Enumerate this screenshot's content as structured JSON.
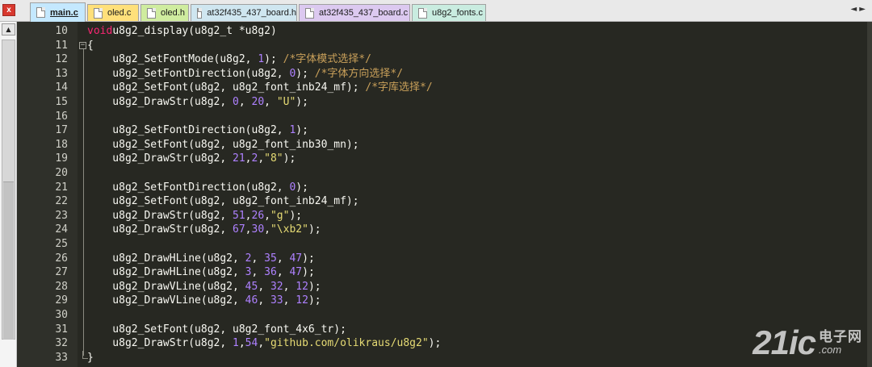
{
  "window": {
    "close_glyph": "x",
    "tab_scroll_glyph": "◄ ►"
  },
  "tabs": [
    {
      "label": "main.c",
      "active": true,
      "color": "#c4e8ff"
    },
    {
      "label": "oled.c",
      "active": false,
      "color": "#ffe07a"
    },
    {
      "label": "oled.h",
      "active": false,
      "color": "#cfec9f"
    },
    {
      "label": "at32f435_437_board.h",
      "active": false,
      "color": "#cfe6f0"
    },
    {
      "label": "at32f435_437_board.c",
      "active": false,
      "color": "#dcc9f0"
    },
    {
      "label": "u8g2_fonts.c",
      "active": false,
      "color": "#c9ece0"
    }
  ],
  "scrollbar": {
    "up_glyph": "▲"
  },
  "editor": {
    "lines": [
      {
        "n": "10",
        "fold": "",
        "tokens": [
          [
            "kw",
            "void"
          ],
          [
            "",
            "u8g2_display(u8g2_t *u8g2)"
          ]
        ]
      },
      {
        "n": "11",
        "fold": "open",
        "tokens": [
          [
            "",
            "{"
          ]
        ]
      },
      {
        "n": "12",
        "fold": "",
        "tokens": [
          [
            "",
            "    u8g2_SetFontMode(u8g2, "
          ],
          [
            "num",
            "1"
          ],
          [
            "",
            "); "
          ],
          [
            "cmt",
            "/*字体模式选择*/"
          ]
        ]
      },
      {
        "n": "13",
        "fold": "",
        "tokens": [
          [
            "",
            "    u8g2_SetFontDirection(u8g2, "
          ],
          [
            "num",
            "0"
          ],
          [
            "",
            "); "
          ],
          [
            "cmt",
            "/*字体方向选择*/"
          ]
        ]
      },
      {
        "n": "14",
        "fold": "",
        "tokens": [
          [
            "",
            "    u8g2_SetFont(u8g2, u8g2_font_inb24_mf); "
          ],
          [
            "cmt",
            "/*字库选择*/"
          ]
        ]
      },
      {
        "n": "15",
        "fold": "",
        "tokens": [
          [
            "",
            "    u8g2_DrawStr(u8g2, "
          ],
          [
            "num",
            "0"
          ],
          [
            "",
            ", "
          ],
          [
            "num",
            "20"
          ],
          [
            "",
            ", "
          ],
          [
            "str",
            "\"U\""
          ],
          [
            "",
            ");"
          ]
        ]
      },
      {
        "n": "16",
        "fold": "",
        "tokens": []
      },
      {
        "n": "17",
        "fold": "",
        "tokens": [
          [
            "",
            "    u8g2_SetFontDirection(u8g2, "
          ],
          [
            "num",
            "1"
          ],
          [
            "",
            ");"
          ]
        ]
      },
      {
        "n": "18",
        "fold": "",
        "tokens": [
          [
            "",
            "    u8g2_SetFont(u8g2, u8g2_font_inb30_mn);"
          ]
        ]
      },
      {
        "n": "19",
        "fold": "",
        "tokens": [
          [
            "",
            "    u8g2_DrawStr(u8g2, "
          ],
          [
            "num",
            "21"
          ],
          [
            "",
            ","
          ],
          [
            "num",
            "2"
          ],
          [
            "",
            ","
          ],
          [
            "str",
            "\"8\""
          ],
          [
            "",
            ");"
          ]
        ]
      },
      {
        "n": "20",
        "fold": "",
        "tokens": []
      },
      {
        "n": "21",
        "fold": "",
        "tokens": [
          [
            "",
            "    u8g2_SetFontDirection(u8g2, "
          ],
          [
            "num",
            "0"
          ],
          [
            "",
            ");"
          ]
        ]
      },
      {
        "n": "22",
        "fold": "",
        "tokens": [
          [
            "",
            "    u8g2_SetFont(u8g2, u8g2_font_inb24_mf);"
          ]
        ]
      },
      {
        "n": "23",
        "fold": "",
        "tokens": [
          [
            "",
            "    u8g2_DrawStr(u8g2, "
          ],
          [
            "num",
            "51"
          ],
          [
            "",
            ","
          ],
          [
            "num",
            "26"
          ],
          [
            "",
            ","
          ],
          [
            "str",
            "\"g\""
          ],
          [
            "",
            ");"
          ]
        ]
      },
      {
        "n": "24",
        "fold": "",
        "tokens": [
          [
            "",
            "    u8g2_DrawStr(u8g2, "
          ],
          [
            "num",
            "67"
          ],
          [
            "",
            ","
          ],
          [
            "num",
            "30"
          ],
          [
            "",
            ","
          ],
          [
            "str",
            "\"\\xb2\""
          ],
          [
            "",
            ");"
          ]
        ]
      },
      {
        "n": "25",
        "fold": "",
        "tokens": []
      },
      {
        "n": "26",
        "fold": "",
        "tokens": [
          [
            "",
            "    u8g2_DrawHLine(u8g2, "
          ],
          [
            "num",
            "2"
          ],
          [
            "",
            ", "
          ],
          [
            "num",
            "35"
          ],
          [
            "",
            ", "
          ],
          [
            "num",
            "47"
          ],
          [
            "",
            ");"
          ]
        ]
      },
      {
        "n": "27",
        "fold": "",
        "tokens": [
          [
            "",
            "    u8g2_DrawHLine(u8g2, "
          ],
          [
            "num",
            "3"
          ],
          [
            "",
            ", "
          ],
          [
            "num",
            "36"
          ],
          [
            "",
            ", "
          ],
          [
            "num",
            "47"
          ],
          [
            "",
            ");"
          ]
        ]
      },
      {
        "n": "28",
        "fold": "",
        "tokens": [
          [
            "",
            "    u8g2_DrawVLine(u8g2, "
          ],
          [
            "num",
            "45"
          ],
          [
            "",
            ", "
          ],
          [
            "num",
            "32"
          ],
          [
            "",
            ", "
          ],
          [
            "num",
            "12"
          ],
          [
            "",
            ");"
          ]
        ]
      },
      {
        "n": "29",
        "fold": "",
        "tokens": [
          [
            "",
            "    u8g2_DrawVLine(u8g2, "
          ],
          [
            "num",
            "46"
          ],
          [
            "",
            ", "
          ],
          [
            "num",
            "33"
          ],
          [
            "",
            ", "
          ],
          [
            "num",
            "12"
          ],
          [
            "",
            ");"
          ]
        ]
      },
      {
        "n": "30",
        "fold": "",
        "tokens": []
      },
      {
        "n": "31",
        "fold": "",
        "tokens": [
          [
            "",
            "    u8g2_SetFont(u8g2, u8g2_font_4x6_tr);"
          ]
        ]
      },
      {
        "n": "32",
        "fold": "",
        "tokens": [
          [
            "",
            "    u8g2_DrawStr(u8g2, "
          ],
          [
            "num",
            "1"
          ],
          [
            "",
            ","
          ],
          [
            "num",
            "54"
          ],
          [
            "",
            ","
          ],
          [
            "str",
            "\"github.com/olikraus/u8g2\""
          ],
          [
            "",
            ");"
          ]
        ]
      },
      {
        "n": "33",
        "fold": "end",
        "tokens": [
          [
            "",
            "}"
          ]
        ]
      }
    ]
  },
  "watermark": {
    "big": "21ic",
    "cn": "电子网",
    "domain": ".com"
  }
}
